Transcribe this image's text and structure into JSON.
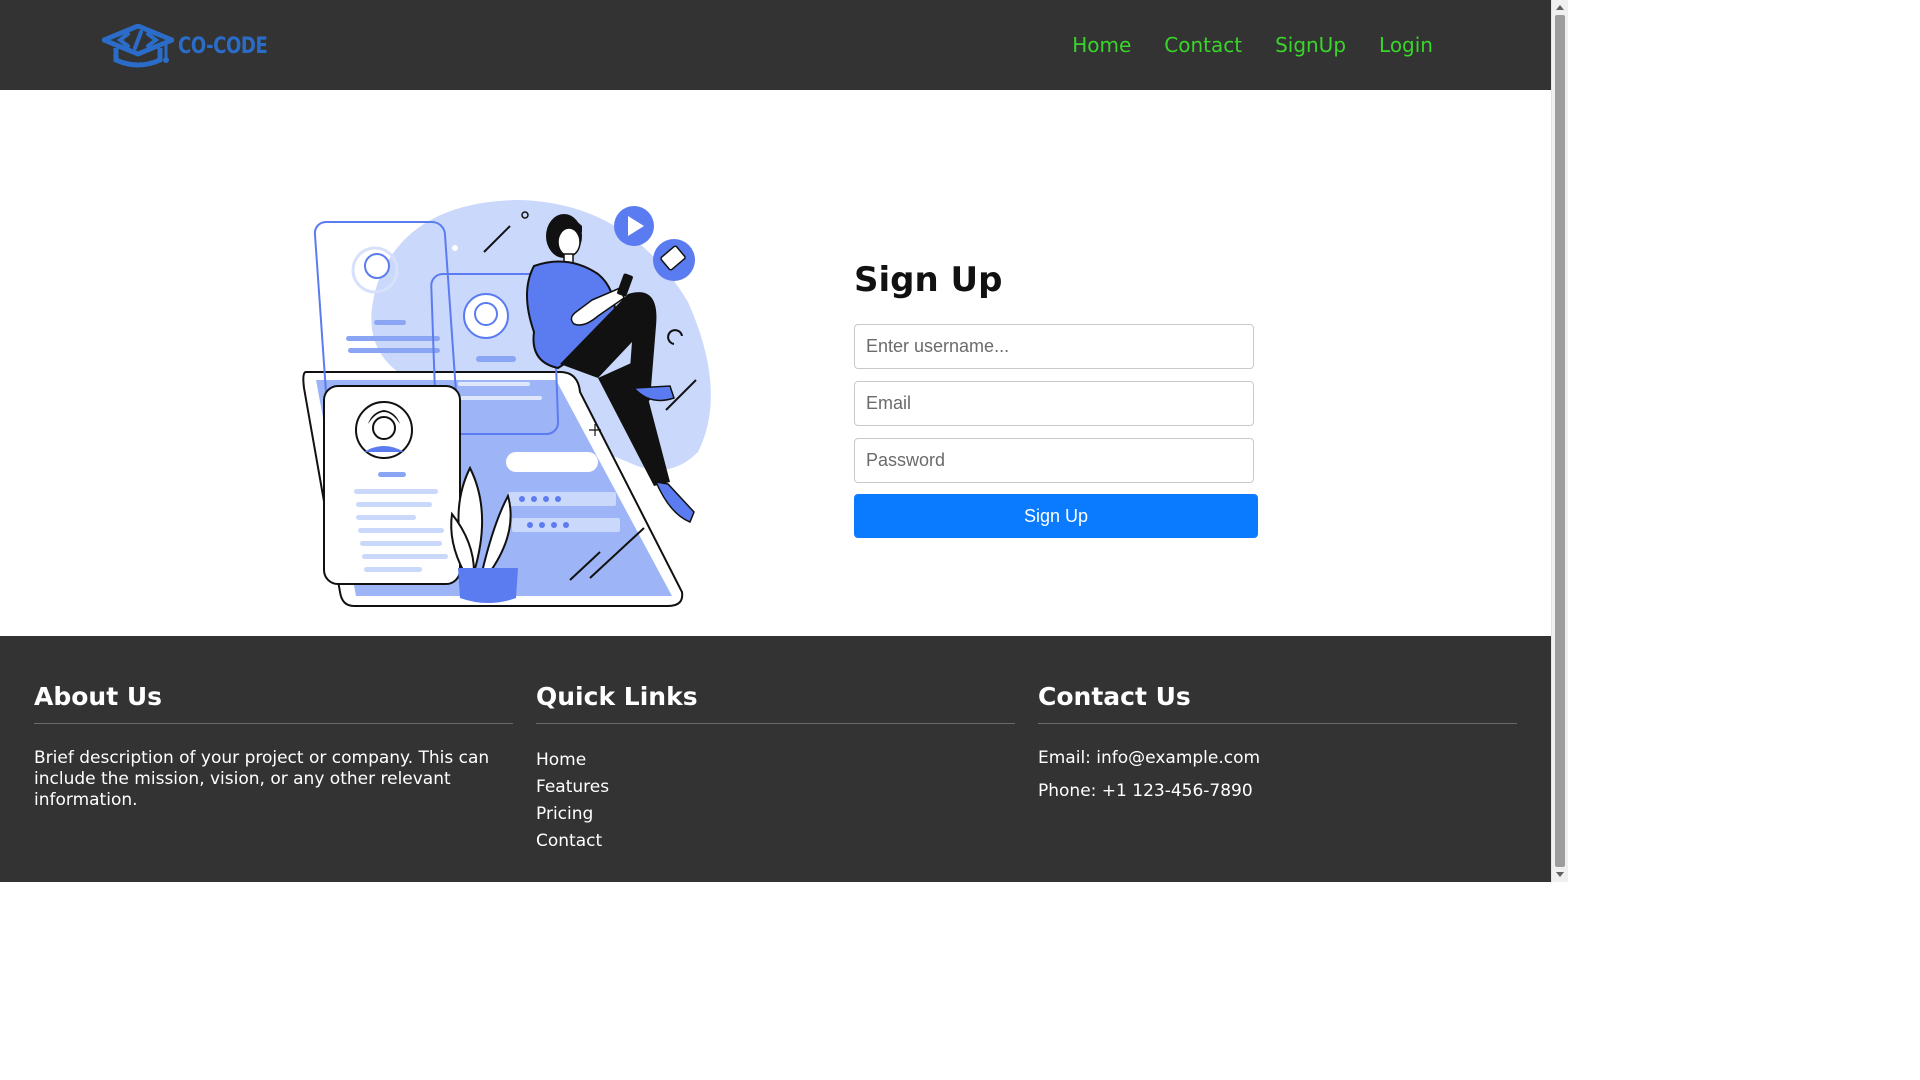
{
  "header": {
    "logo_text": "CO-CODE",
    "nav": [
      "Home",
      "Contact",
      "SignUp",
      "Login"
    ]
  },
  "form": {
    "title": "Sign Up",
    "username_placeholder": "Enter username...",
    "email_placeholder": "Email",
    "password_placeholder": "Password",
    "submit_label": "Sign Up"
  },
  "footer": {
    "about": {
      "title": "About Us",
      "text": "Brief description of your project or company. This can include the mission, vision, or any other relevant information."
    },
    "quick_links": {
      "title": "Quick Links",
      "items": [
        "Home",
        "Features",
        "Pricing",
        "Contact"
      ]
    },
    "contact": {
      "title": "Contact Us",
      "email": "Email: info@example.com",
      "phone": "Phone: +1 123-456-7890"
    }
  },
  "icons": {
    "logo": "graduation-cap-code-icon",
    "illustration": "woman-with-phone-signup-illustration"
  },
  "colors": {
    "header_bg": "#333333",
    "nav_link": "#39d52a",
    "logo": "#2a6cc7",
    "button_bg": "#0a7bff",
    "illustration_accent": "#5b7cf0"
  }
}
